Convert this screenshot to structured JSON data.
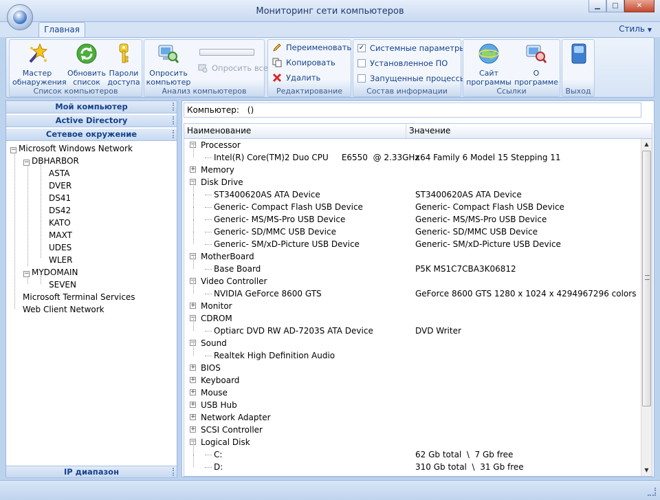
{
  "window": {
    "title": "Мониторинг сети компьютеров",
    "min": "▁",
    "max": "□",
    "close": "✕"
  },
  "ribbon": {
    "tab_home": "Главная",
    "style_menu": "Стиль",
    "groups": {
      "computers": {
        "label": "Список компьютеров",
        "wizard_l1": "Мастер",
        "wizard_l2": "обнаружения",
        "refresh_l1": "Обновить",
        "refresh_l2": "список",
        "passwords_l1": "Пароли",
        "passwords_l2": "доступа"
      },
      "analysis": {
        "label": "Анализ компьютеров",
        "query_l1": "Опросить",
        "query_l2": "компьютер",
        "query_all": "Опросить все"
      },
      "edit": {
        "label": "Редактирование",
        "rename": "Переименовать",
        "copy": "Копировать",
        "delete": "Удалить"
      },
      "info": {
        "label": "Состав информации",
        "system": "Системные параметры",
        "installed": "Установленное ПО",
        "processes": "Запущенные процессы"
      },
      "links": {
        "label": "Ссылки",
        "site_l1": "Сайт",
        "site_l2": "программы",
        "about_l1": "О",
        "about_l2": "программе"
      },
      "exit": {
        "label": "Выход"
      }
    },
    "checked": {
      "system": "✓",
      "installed": "",
      "processes": ""
    }
  },
  "sidebar": {
    "my_computer": "Мой компьютер",
    "active_directory": "Active Directory",
    "network": "Сетевое окружение",
    "ip_range": "IP диапазон",
    "tree": {
      "msnet": "Microsoft Windows Network",
      "dbharbor": "DBHARBOR",
      "hosts1": [
        "ASTA",
        "DVER",
        "DS41",
        "DS42",
        "KATO",
        "MAXT",
        "UDES",
        "WLER"
      ],
      "mydomain": "MYDOMAIN",
      "seven": "SEVEN",
      "mts": "Microsoft Terminal Services",
      "wcn": "Web Client Network"
    }
  },
  "main": {
    "computer_label": "Компьютер:",
    "computer_value": "()",
    "col_name": "Наименование",
    "col_value": "Значение",
    "rows": [
      {
        "kind": "cat",
        "exp": "−",
        "name": "Processor"
      },
      {
        "kind": "item",
        "name": "Intel(R) Core(TM)2 Duo CPU     E6550  @ 2.33GHz",
        "value": "x64 Family 6 Model 15 Stepping 11"
      },
      {
        "kind": "cat",
        "exp": "+",
        "name": "Memory"
      },
      {
        "kind": "cat",
        "exp": "−",
        "name": "Disk Drive"
      },
      {
        "kind": "item",
        "name": "ST3400620AS ATA Device",
        "value": "ST3400620AS ATA Device"
      },
      {
        "kind": "item",
        "name": "Generic- Compact Flash USB Device",
        "value": "Generic- Compact Flash USB Device"
      },
      {
        "kind": "item",
        "name": "Generic- MS/MS-Pro USB Device",
        "value": "Generic- MS/MS-Pro USB Device"
      },
      {
        "kind": "item",
        "name": "Generic- SD/MMC USB Device",
        "value": "Generic- SD/MMC USB Device"
      },
      {
        "kind": "item",
        "name": "Generic- SM/xD-Picture USB Device",
        "value": "Generic- SM/xD-Picture USB Device"
      },
      {
        "kind": "cat",
        "exp": "−",
        "name": "MotherBoard"
      },
      {
        "kind": "item",
        "name": "Base Board",
        "value": "P5K MS1C7CBA3K06812"
      },
      {
        "kind": "cat",
        "exp": "−",
        "name": "Video Controller"
      },
      {
        "kind": "item",
        "name": "NVIDIA GeForce 8600 GTS",
        "value": "GeForce 8600 GTS 1280 x 1024 x 4294967296 colors"
      },
      {
        "kind": "cat",
        "exp": "+",
        "name": "Monitor"
      },
      {
        "kind": "cat",
        "exp": "−",
        "name": "CDROM"
      },
      {
        "kind": "item",
        "name": "Optiarc DVD RW AD-7203S ATA Device",
        "value": "DVD Writer"
      },
      {
        "kind": "cat",
        "exp": "−",
        "name": "Sound"
      },
      {
        "kind": "item",
        "name": "Realtek High Definition Audio",
        "value": ""
      },
      {
        "kind": "cat",
        "exp": "+",
        "name": "BIOS"
      },
      {
        "kind": "cat",
        "exp": "+",
        "name": "Keyboard"
      },
      {
        "kind": "cat",
        "exp": "+",
        "name": "Mouse"
      },
      {
        "kind": "cat",
        "exp": "+",
        "name": "USB Hub"
      },
      {
        "kind": "cat",
        "exp": "+",
        "name": "Network Adapter"
      },
      {
        "kind": "cat",
        "exp": "+",
        "name": "SCSI Controller"
      },
      {
        "kind": "cat",
        "exp": "−",
        "name": "Logical Disk"
      },
      {
        "kind": "item",
        "name": "C:",
        "value": "62 Gb total  \\  7 Gb free"
      },
      {
        "kind": "item",
        "name": "D:",
        "value": "310 Gb total  \\  31 Gb free"
      }
    ]
  },
  "icons": {
    "wizard": "wizard-icon",
    "refresh": "refresh-icon",
    "key": "key-icon",
    "query": "query-computer-icon",
    "globe": "globe-icon",
    "about": "about-icon",
    "exit": "exit-icon"
  }
}
